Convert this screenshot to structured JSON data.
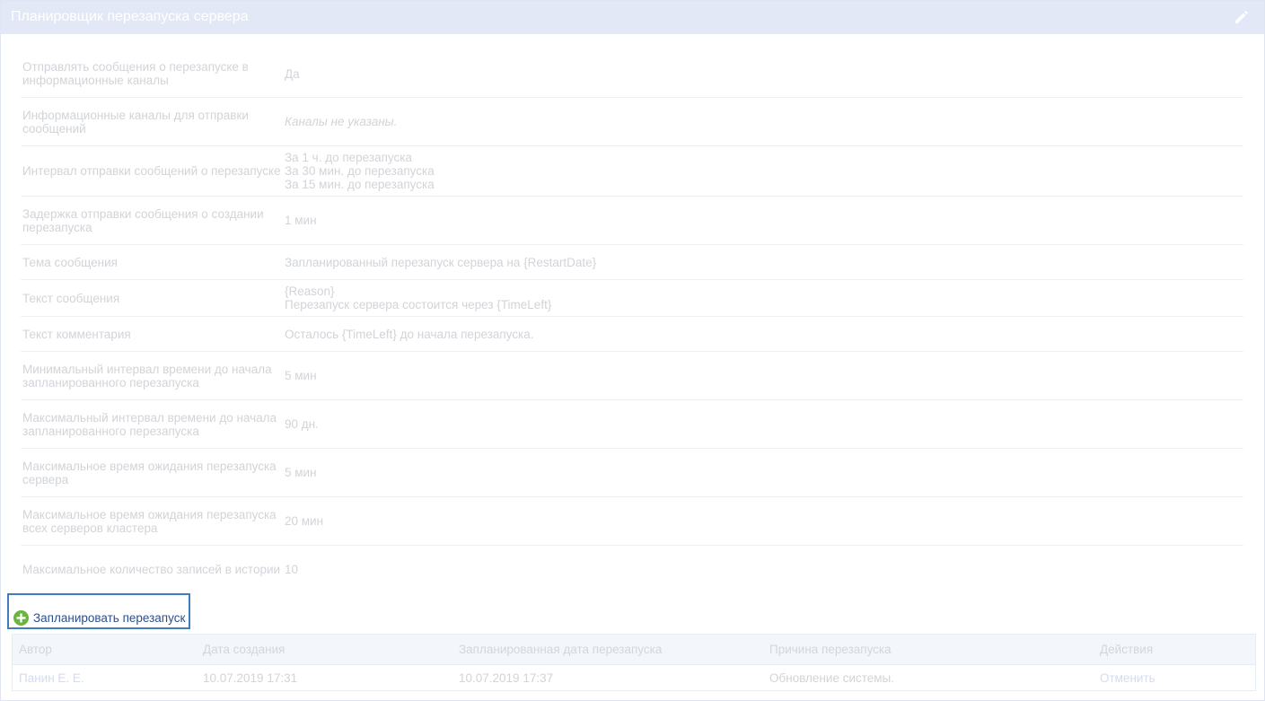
{
  "header": {
    "title": "Планировщик перезапуска сервера",
    "edit_icon": "pencil-icon"
  },
  "settings": [
    {
      "label": "Отправлять сообщения о перезапуске в информационные каналы",
      "value_lines": [
        "Да"
      ]
    },
    {
      "label": "Информационные каналы для отправки сообщений",
      "value_lines": [
        "Каналы не указаны."
      ],
      "italic": true
    },
    {
      "label": "Интервал отправки сообщений о перезапуске",
      "value_lines": [
        "За 1 ч. до перезапуска",
        "За 30 мин. до перезапуска",
        "За 15 мин. до перезапуска"
      ]
    },
    {
      "label": "Задержка отправки сообщения о создании перезапуска",
      "value_lines": [
        "1 мин"
      ]
    },
    {
      "label": "Тема сообщения",
      "value_lines": [
        "Запланированный перезапуск сервера на {RestartDate}"
      ]
    },
    {
      "label": "Текст сообщения",
      "value_lines": [
        "{Reason}",
        "Перезапуск сервера состоится через {TimeLeft}"
      ]
    },
    {
      "label": "Текст комментария",
      "value_lines": [
        "Осталось {TimeLeft} до начала перезапуска."
      ]
    },
    {
      "label": "Минимальный интервал времени до начала запланированного перезапуска",
      "value_lines": [
        "5 мин"
      ]
    },
    {
      "label": "Максимальный интервал времени до начала запланированного перезапуска",
      "value_lines": [
        "90 дн."
      ]
    },
    {
      "label": "Максимальное время ожидания перезапуска сервера",
      "value_lines": [
        "5 мин"
      ]
    },
    {
      "label": "Максимальное время ожидания перезапуска всех серверов кластера",
      "value_lines": [
        "20 мин"
      ]
    },
    {
      "label": "Максимальное количество записей в истории",
      "value_lines": [
        "10"
      ]
    }
  ],
  "schedule_button": {
    "label": "Запланировать перезапуск",
    "icon": "plus-circle-icon",
    "icon_color": "#6cb33f"
  },
  "history_table": {
    "columns": [
      "Автор",
      "Дата создания",
      "Запланированная дата перезапуска",
      "Причина перезапуска",
      "Действия"
    ],
    "rows": [
      {
        "author": "Панин Е. Е.",
        "created": "10.07.2019 17:31",
        "scheduled": "10.07.2019 17:37",
        "reason": "Обновление системы.",
        "action": "Отменить"
      }
    ]
  },
  "colors": {
    "header_bg": "#e3e8f6",
    "highlight_border": "#3f7cc0",
    "button_text": "#2a4f8f"
  }
}
